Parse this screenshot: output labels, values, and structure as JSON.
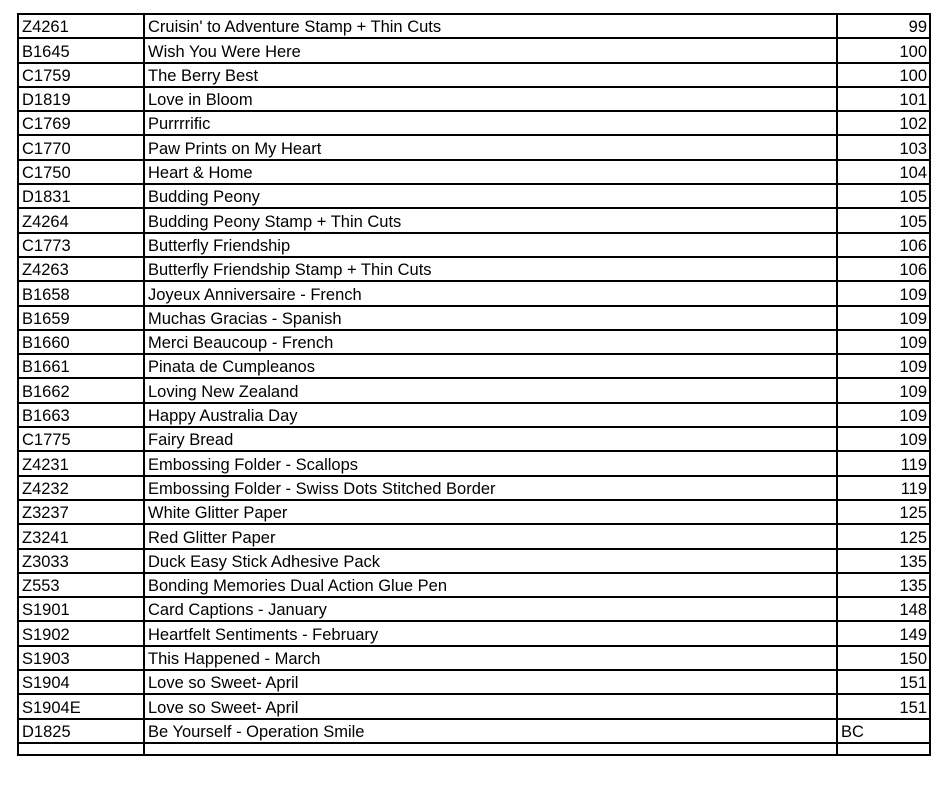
{
  "table": {
    "rows": [
      {
        "code": "Z4261",
        "name": "Cruisin' to Adventure Stamp + Thin Cuts",
        "page": "99",
        "page_align": "right"
      },
      {
        "code": "B1645",
        "name": "Wish You Were Here",
        "page": "100",
        "page_align": "right"
      },
      {
        "code": "C1759",
        "name": "The Berry Best",
        "page": "100",
        "page_align": "right"
      },
      {
        "code": "D1819",
        "name": "Love in Bloom",
        "page": "101",
        "page_align": "right"
      },
      {
        "code": "C1769",
        "name": "Purrrrific",
        "page": "102",
        "page_align": "right"
      },
      {
        "code": "C1770",
        "name": "Paw Prints on My Heart",
        "page": "103",
        "page_align": "right"
      },
      {
        "code": "C1750",
        "name": "Heart & Home",
        "page": "104",
        "page_align": "right"
      },
      {
        "code": "D1831",
        "name": "Budding Peony",
        "page": "105",
        "page_align": "right"
      },
      {
        "code": "Z4264",
        "name": "Budding Peony Stamp + Thin Cuts",
        "page": "105",
        "page_align": "right"
      },
      {
        "code": "C1773",
        "name": "Butterfly Friendship",
        "page": "106",
        "page_align": "right"
      },
      {
        "code": "Z4263",
        "name": "Butterfly Friendship Stamp + Thin Cuts",
        "page": "106",
        "page_align": "right"
      },
      {
        "code": "B1658",
        "name": "Joyeux Anniversaire - French",
        "page": "109",
        "page_align": "right"
      },
      {
        "code": "B1659",
        "name": "Muchas Gracias - Spanish",
        "page": "109",
        "page_align": "right"
      },
      {
        "code": "B1660",
        "name": "Merci Beaucoup - French",
        "page": "109",
        "page_align": "right"
      },
      {
        "code": "B1661",
        "name": "Pinata de Cumpleanos",
        "page": "109",
        "page_align": "right"
      },
      {
        "code": "B1662",
        "name": "Loving New Zealand",
        "page": "109",
        "page_align": "right"
      },
      {
        "code": "B1663",
        "name": "Happy Australia Day",
        "page": "109",
        "page_align": "right"
      },
      {
        "code": "C1775",
        "name": "Fairy Bread",
        "page": "109",
        "page_align": "right"
      },
      {
        "code": "Z4231",
        "name": "Embossing Folder - Scallops",
        "page": "119",
        "page_align": "right"
      },
      {
        "code": "Z4232",
        "name": "Embossing Folder - Swiss Dots Stitched Border",
        "page": "119",
        "page_align": "right"
      },
      {
        "code": "Z3237",
        "name": "White Glitter Paper",
        "page": "125",
        "page_align": "right"
      },
      {
        "code": "Z3241",
        "name": "Red Glitter Paper",
        "page": "125",
        "page_align": "right"
      },
      {
        "code": "Z3033",
        "name": "Duck Easy Stick Adhesive Pack",
        "page": "135",
        "page_align": "right"
      },
      {
        "code": "Z553",
        "name": "Bonding Memories Dual Action Glue Pen",
        "page": "135",
        "page_align": "right"
      },
      {
        "code": "S1901",
        "name": "Card Captions - January",
        "page": "148",
        "page_align": "right"
      },
      {
        "code": "S1902",
        "name": "Heartfelt Sentiments - February",
        "page": "149",
        "page_align": "right"
      },
      {
        "code": "S1903",
        "name": "This Happened - March",
        "page": "150",
        "page_align": "right"
      },
      {
        "code": "S1904",
        "name": "Love so Sweet- April",
        "page": "151",
        "page_align": "right"
      },
      {
        "code": "S1904E",
        "name": "Love so Sweet- April",
        "page": "151",
        "page_align": "right"
      },
      {
        "code": "D1825",
        "name": "Be Yourself - Operation Smile",
        "page": "BC",
        "page_align": "left"
      }
    ]
  }
}
